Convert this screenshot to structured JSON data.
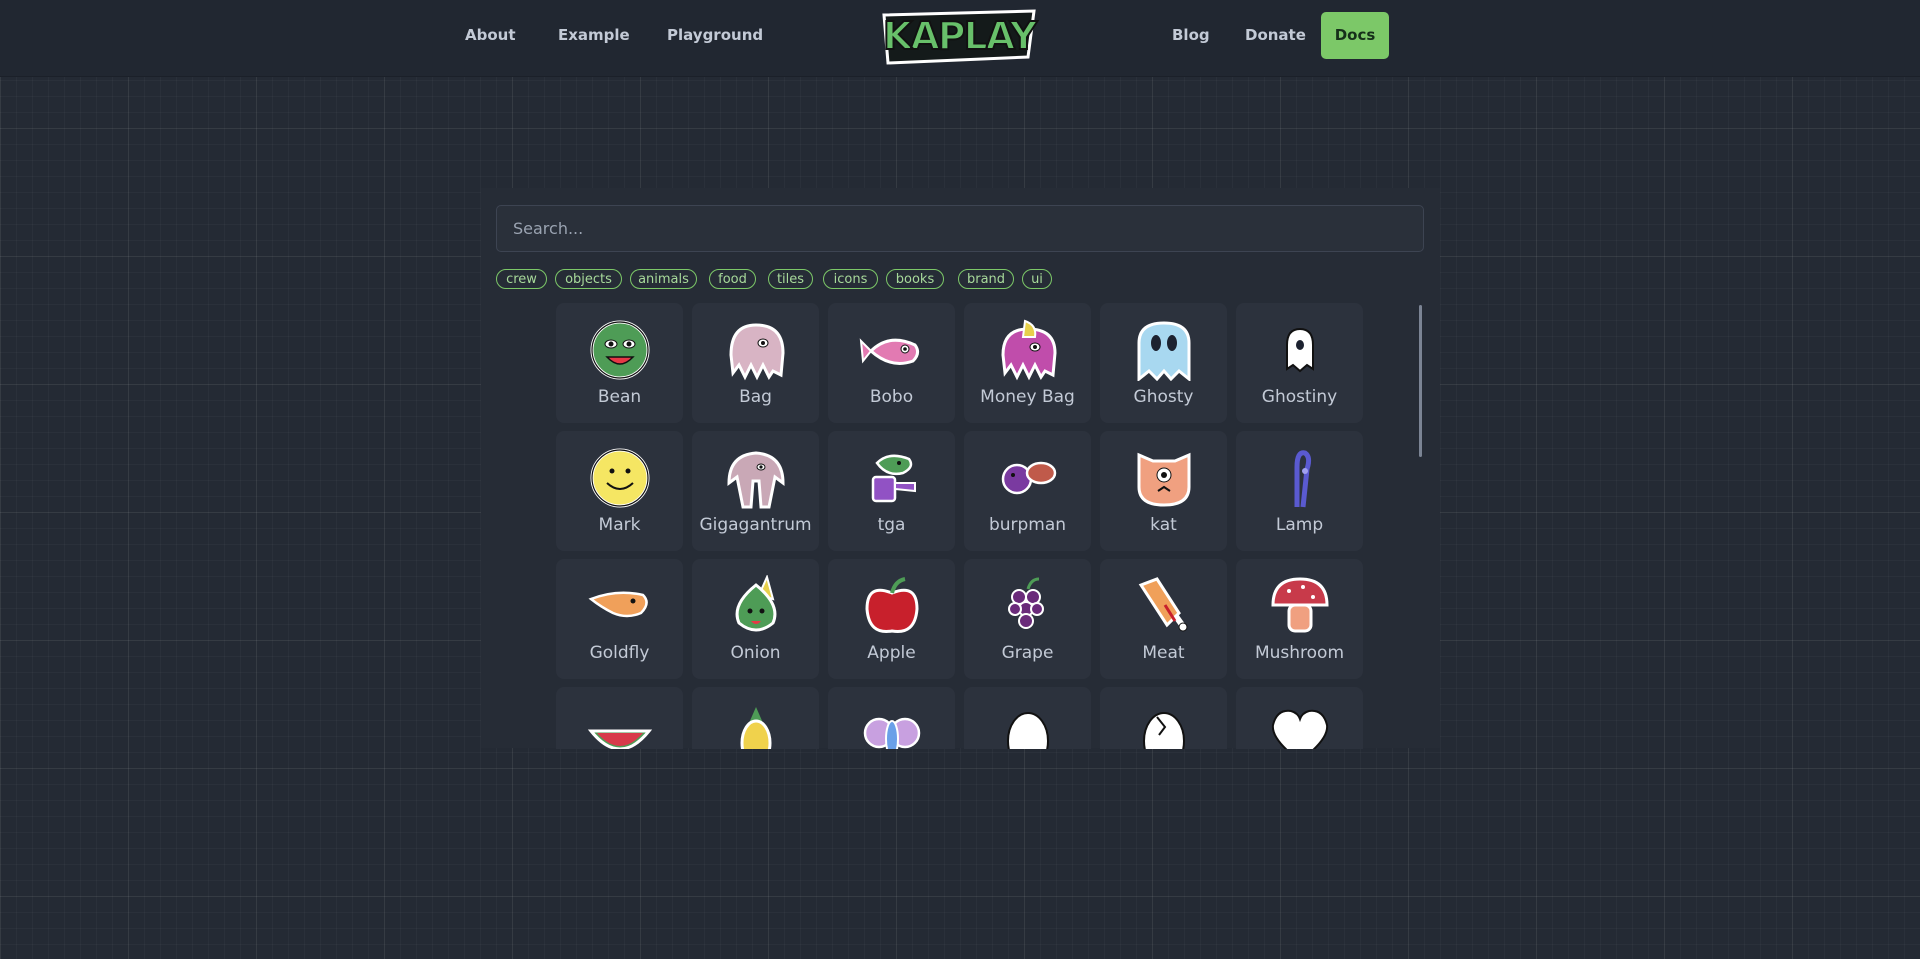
{
  "nav": {
    "about": "About",
    "example": "Example",
    "playground": "Playground",
    "blog": "Blog",
    "donate": "Donate",
    "docs": "Docs",
    "logo_text": "KAPLAY",
    "docs_color": "#7cc868"
  },
  "search": {
    "placeholder": "Search..."
  },
  "tags": [
    "crew",
    "objects",
    "animals",
    "food",
    "tiles",
    "icons",
    "books",
    "brand",
    "ui"
  ],
  "sprites": [
    {
      "name": "Bean",
      "icon": "bean-icon"
    },
    {
      "name": "Bag",
      "icon": "bag-icon"
    },
    {
      "name": "Bobo",
      "icon": "bobo-icon"
    },
    {
      "name": "Money Bag",
      "icon": "money-bag-icon"
    },
    {
      "name": "Ghosty",
      "icon": "ghosty-icon"
    },
    {
      "name": "Ghostiny",
      "icon": "ghostiny-icon"
    },
    {
      "name": "Mark",
      "icon": "mark-icon"
    },
    {
      "name": "Gigagantrum",
      "icon": "gigagantrum-icon"
    },
    {
      "name": "tga",
      "icon": "tga-icon"
    },
    {
      "name": "burpman",
      "icon": "burpman-icon"
    },
    {
      "name": "kat",
      "icon": "kat-icon"
    },
    {
      "name": "Lamp",
      "icon": "lamp-icon"
    },
    {
      "name": "Goldfly",
      "icon": "goldfly-icon"
    },
    {
      "name": "Onion",
      "icon": "onion-icon"
    },
    {
      "name": "Apple",
      "icon": "apple-icon"
    },
    {
      "name": "Grape",
      "icon": "grape-icon"
    },
    {
      "name": "Meat",
      "icon": "meat-icon"
    },
    {
      "name": "Mushroom",
      "icon": "mushroom-icon"
    },
    {
      "name": "",
      "icon": "watermelon-icon"
    },
    {
      "name": "",
      "icon": "pineapple-icon"
    },
    {
      "name": "",
      "icon": "butterfly-icon"
    },
    {
      "name": "",
      "icon": "egg-icon"
    },
    {
      "name": "",
      "icon": "cracked-egg-icon"
    },
    {
      "name": "",
      "icon": "heart-icon"
    }
  ]
}
